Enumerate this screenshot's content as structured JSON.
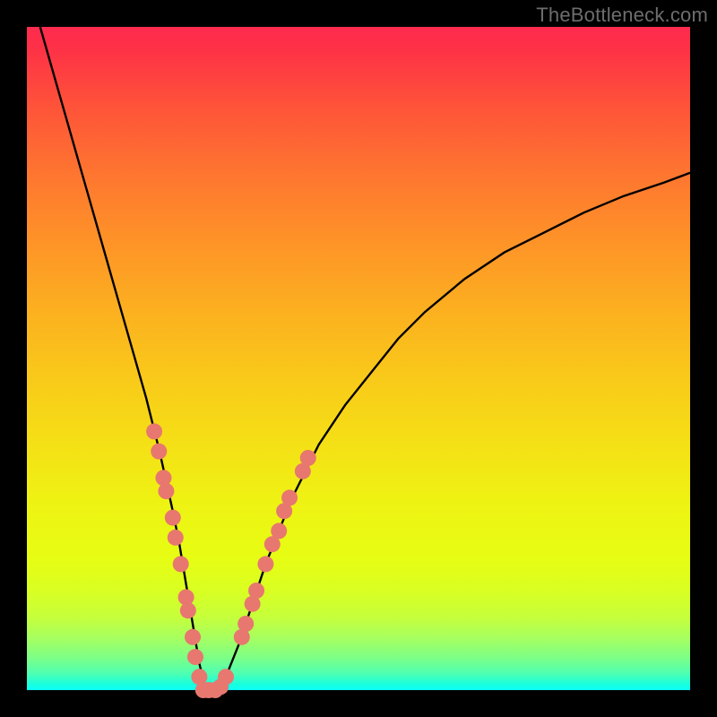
{
  "watermark": "TheBottleneck.com",
  "colors": {
    "curve_stroke": "#000000",
    "marker_fill": "#e7776f",
    "marker_stroke": "#d55e56",
    "bg_black": "#000000"
  },
  "chart_data": {
    "type": "line",
    "title": "",
    "xlabel": "",
    "ylabel": "",
    "xlim": [
      0,
      100
    ],
    "ylim": [
      0,
      100
    ],
    "grid": false,
    "series": [
      {
        "name": "bottleneck-curve",
        "x": [
          2,
          4,
          6,
          8,
          10,
          12,
          14,
          16,
          18,
          20,
          22,
          23,
          24,
          25,
          26,
          27,
          28,
          29,
          30,
          32,
          34,
          36,
          38,
          40,
          44,
          48,
          52,
          56,
          60,
          66,
          72,
          78,
          84,
          90,
          96,
          100
        ],
        "y": [
          100,
          93,
          86,
          79,
          72,
          65,
          58,
          51,
          44,
          36,
          27,
          22,
          16,
          10,
          4,
          0,
          0,
          0,
          2,
          7,
          13,
          19,
          24,
          29,
          37,
          43,
          48,
          53,
          57,
          62,
          66,
          69,
          72,
          74.5,
          76.5,
          78
        ]
      }
    ],
    "markers": {
      "name": "sample-points",
      "points": [
        {
          "x": 19.2,
          "y": 39
        },
        {
          "x": 19.9,
          "y": 36
        },
        {
          "x": 20.6,
          "y": 32
        },
        {
          "x": 21.0,
          "y": 30
        },
        {
          "x": 22.0,
          "y": 26
        },
        {
          "x": 22.4,
          "y": 23
        },
        {
          "x": 23.2,
          "y": 19
        },
        {
          "x": 24.0,
          "y": 14
        },
        {
          "x": 24.3,
          "y": 12
        },
        {
          "x": 25.0,
          "y": 8
        },
        {
          "x": 25.4,
          "y": 5
        },
        {
          "x": 26.0,
          "y": 2
        },
        {
          "x": 26.6,
          "y": 0
        },
        {
          "x": 27.4,
          "y": 0
        },
        {
          "x": 28.4,
          "y": 0
        },
        {
          "x": 29.2,
          "y": 0.5
        },
        {
          "x": 30.0,
          "y": 2
        },
        {
          "x": 32.4,
          "y": 8
        },
        {
          "x": 33.0,
          "y": 10
        },
        {
          "x": 34.0,
          "y": 13
        },
        {
          "x": 34.6,
          "y": 15
        },
        {
          "x": 36.0,
          "y": 19
        },
        {
          "x": 37.0,
          "y": 22
        },
        {
          "x": 38.0,
          "y": 24
        },
        {
          "x": 38.8,
          "y": 27
        },
        {
          "x": 39.6,
          "y": 29
        },
        {
          "x": 41.6,
          "y": 33
        },
        {
          "x": 42.4,
          "y": 35
        }
      ]
    }
  }
}
